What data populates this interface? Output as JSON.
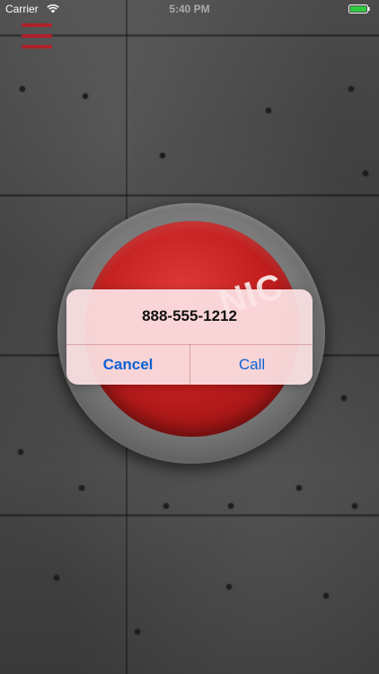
{
  "status_bar": {
    "carrier": "Carrier",
    "time": "5:40 PM",
    "icons": [
      "wifi-icon",
      "battery-icon"
    ],
    "battery_color": "#2ecc40"
  },
  "menu": {
    "icon": "hamburger-menu-icon",
    "color": "#b0202a"
  },
  "panic_button": {
    "label": "NIC",
    "color": "#c41f1f"
  },
  "alert": {
    "message": "888-555-1212",
    "cancel_label": "Cancel",
    "call_label": "Call",
    "button_color": "#0a62d6"
  }
}
